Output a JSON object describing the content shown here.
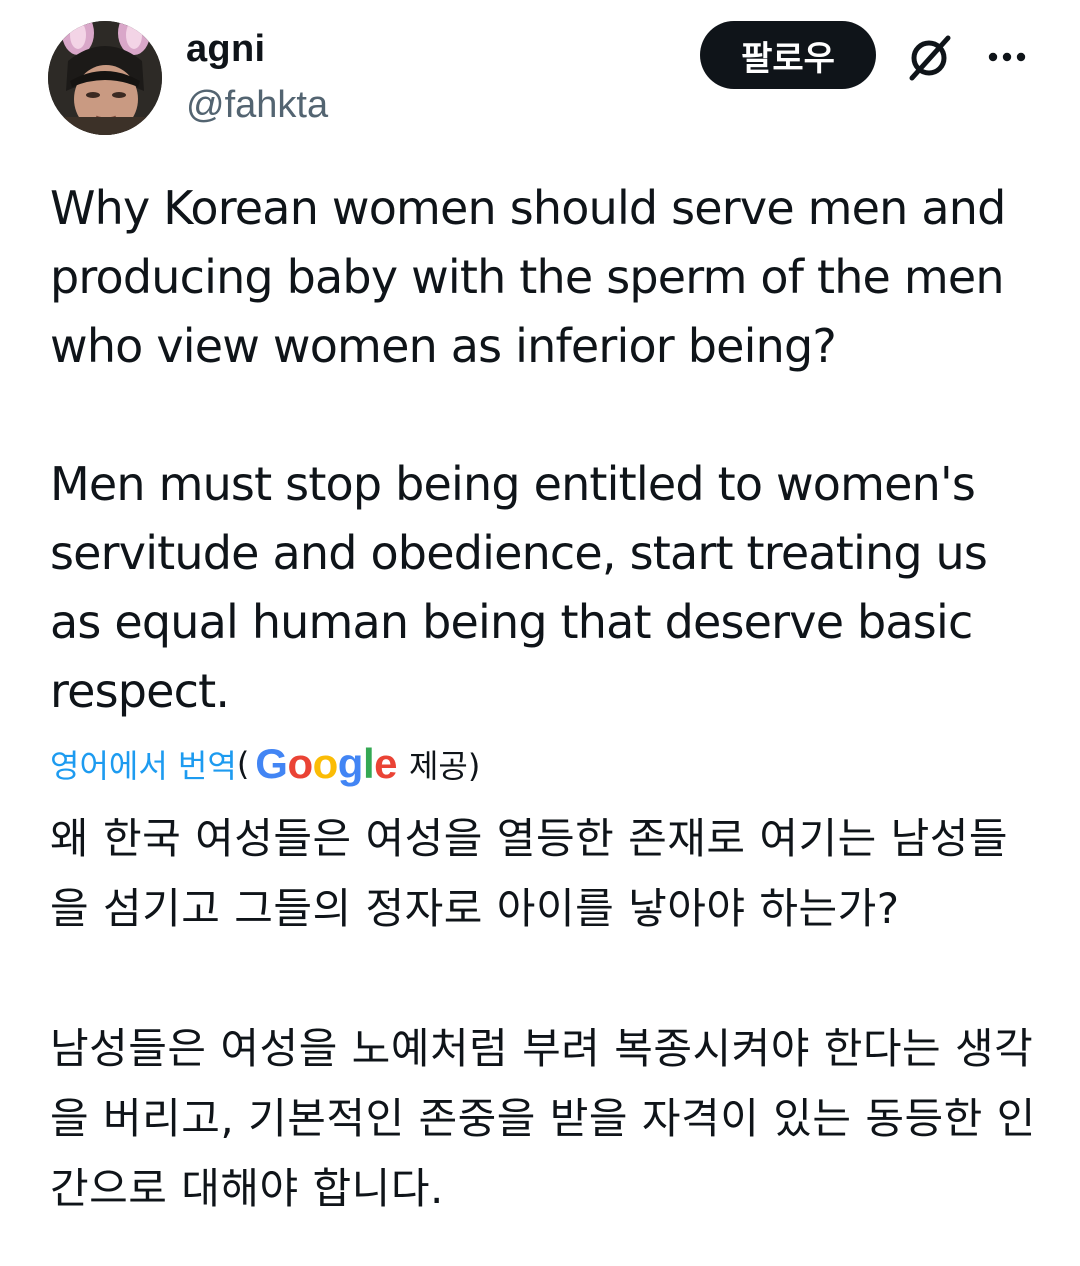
{
  "author": {
    "display_name": "agni",
    "handle": "@fahkta",
    "avatar_icon": "profile-photo"
  },
  "actions": {
    "follow_label": "팔로우",
    "grok_icon": "grok-slash-circle-icon",
    "more_icon": "more-horizontal-icon"
  },
  "tweet": {
    "paragraphs": [
      "Why Korean women should serve men and producing baby with the sperm of the men who view women as inferior being?",
      "Men must stop being entitled to women's servitude and obedience, start treating us as equal human being that deserve basic respect."
    ]
  },
  "translation": {
    "link_label": "영어에서 번역",
    "open_paren": "(",
    "provider_logo": "Google",
    "provided_by": "제공)",
    "paragraphs": [
      "왜 한국 여성들은 여성을 열등한 존재로 여기는 남성들을 섬기고 그들의 정자로 아이를 낳아야 하는가?",
      "남성들은 여성을 노예처럼 부려 복종시켜야 한다는 생각을 버리고, 기본적인 존중을 받을 자격이 있는 동등한 인간으로 대해야 합니다."
    ]
  },
  "colors": {
    "link": "#1d9bf0",
    "text": "#0f1419",
    "secondary": "#536471",
    "button_bg": "#0f1419"
  }
}
